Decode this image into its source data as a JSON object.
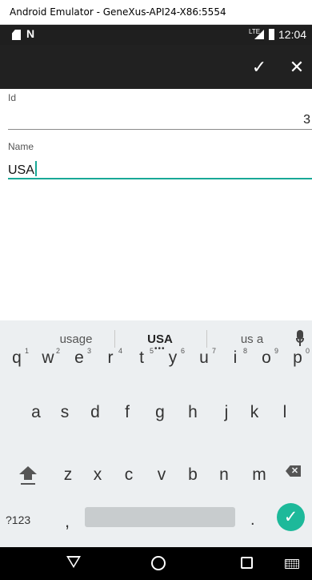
{
  "window": {
    "title": "Android Emulator - GeneXus-API24-X86:5554"
  },
  "status_bar": {
    "network_label": "LTE",
    "time": "12:04",
    "n_glyph": "N"
  },
  "toolbar": {
    "confirm_glyph": "✓",
    "close_glyph": "✕"
  },
  "form": {
    "id_label": "Id",
    "id_value": "3",
    "name_label": "Name",
    "name_value": "USA"
  },
  "keyboard": {
    "suggestions": [
      "usage",
      "USA",
      "us a"
    ],
    "suggestion_more": "•••",
    "row1": [
      {
        "key": "q",
        "hint": "1"
      },
      {
        "key": "w",
        "hint": "2"
      },
      {
        "key": "e",
        "hint": "3"
      },
      {
        "key": "r",
        "hint": "4"
      },
      {
        "key": "t",
        "hint": "5"
      },
      {
        "key": "y",
        "hint": "6"
      },
      {
        "key": "u",
        "hint": "7"
      },
      {
        "key": "i",
        "hint": "8"
      },
      {
        "key": "o",
        "hint": "9"
      },
      {
        "key": "p",
        "hint": "0"
      }
    ],
    "row2": [
      "a",
      "s",
      "d",
      "f",
      "g",
      "h",
      "j",
      "k",
      "l"
    ],
    "row3": [
      "z",
      "x",
      "c",
      "v",
      "b",
      "n",
      "m"
    ],
    "symbols_label": "?123",
    "comma": ",",
    "period": ".",
    "enter_glyph": "✓",
    "backspace_glyph": "✕"
  },
  "colors": {
    "accent": "#19a897",
    "enter": "#1db99a",
    "toolbar": "#212121",
    "keyboard_bg": "#eceff1"
  },
  "icons": {
    "status_bar": [
      "sd-card-icon",
      "n-icon",
      "signal-icon",
      "battery-icon"
    ],
    "toolbar": [
      "check-icon",
      "close-icon"
    ],
    "nav_bar": [
      "back-icon",
      "home-icon",
      "recents-icon",
      "keyboard-icon"
    ]
  }
}
